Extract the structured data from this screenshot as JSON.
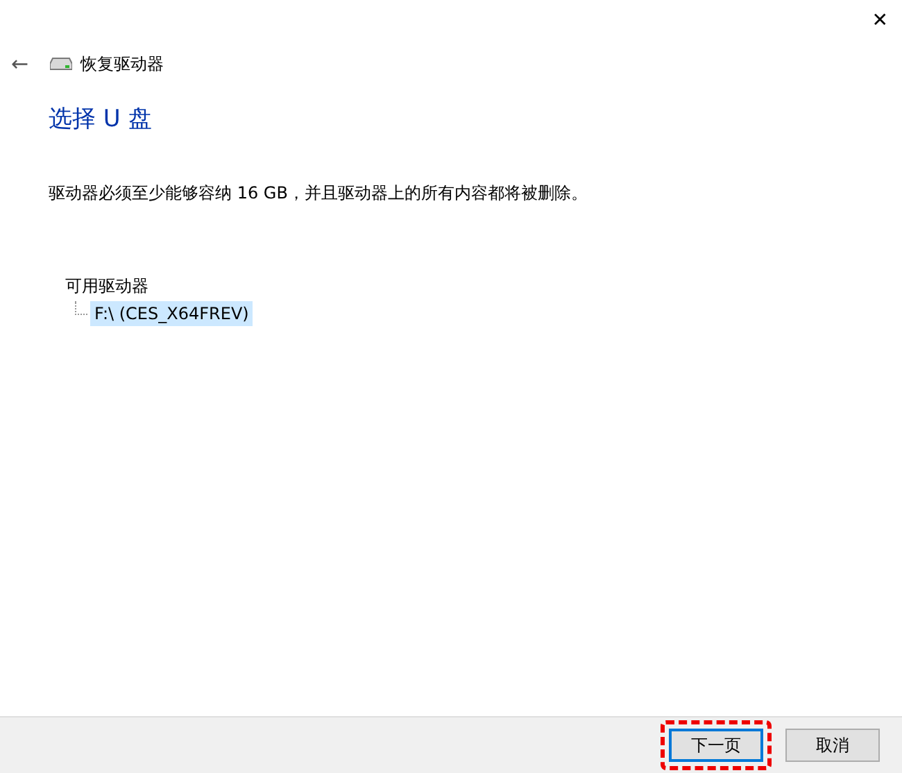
{
  "window": {
    "close": "✕",
    "back": "←",
    "title": "恢复驱动器"
  },
  "heading": "选择 U 盘",
  "message": "驱动器必须至少能够容纳 16 GB，并且驱动器上的所有内容都将被删除。",
  "drives": {
    "label": "可用驱动器",
    "items": [
      {
        "label": "F:\\ (CES_X64FREV)",
        "selected": true
      }
    ]
  },
  "buttons": [
    {
      "label": "下一页",
      "kind": "default",
      "highlighted": true
    },
    {
      "label": "取消",
      "kind": "normal",
      "highlighted": false
    }
  ]
}
